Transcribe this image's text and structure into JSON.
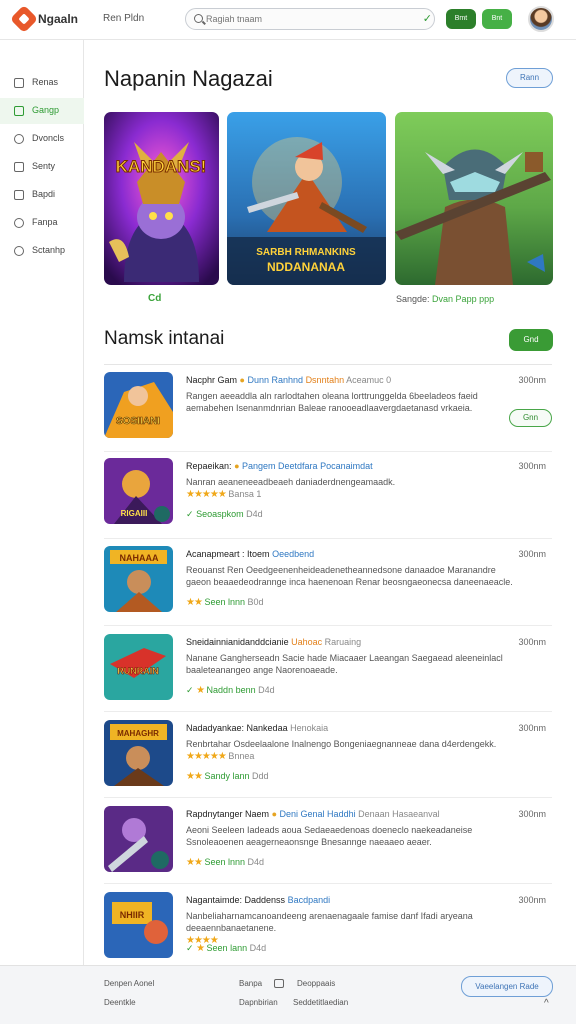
{
  "header": {
    "brand": "Ngaaln",
    "top_link": "Ren Pldn",
    "search_placeholder": "Ragiah tnaam",
    "btn_primary": "Bmt",
    "btn_secondary": "Bnt"
  },
  "sidebar": {
    "items": [
      {
        "label": "Renas",
        "icon": "home-icon",
        "active": false
      },
      {
        "label": "Gangp",
        "icon": "game-icon",
        "active": true
      },
      {
        "label": "Dvoncls",
        "icon": "chat-icon",
        "active": false
      },
      {
        "label": "Senty",
        "icon": "list-icon",
        "active": false
      },
      {
        "label": "Bapdi",
        "icon": "bag-icon",
        "active": false
      },
      {
        "label": "Fanpa",
        "icon": "circle-icon",
        "active": false
      },
      {
        "label": "Sctanhp",
        "icon": "settings-icon",
        "active": false
      }
    ]
  },
  "featured": {
    "title": "Napanin Nagazai",
    "outline_button": "Rann",
    "tiles": [
      {
        "art_text": "KANDANS!"
      },
      {
        "art_text": "SARBH RHMANKINS",
        "art_text2": "NDDANANAA"
      },
      {
        "art_text": ""
      }
    ],
    "left_label": "Cd",
    "right_label": "Sangde:",
    "right_label_highlight": "Dvan Papp ppp"
  },
  "list": {
    "title": "Namsk intanai",
    "header_button": "Gnd",
    "rows": [
      {
        "name": "Nacphr Gam",
        "tag": "Dunn Ranhnd",
        "tag2": "Dsnntahn",
        "extra": "Aceamuc 0",
        "time": "300nm",
        "desc": "Rangen aeeaddla aln rarlodtahen oleana lorttrunggelda 6beeladeos faeid aemabehen Isenanmdnrian Baleae ranooeadlaavergdaetanasd vrkaeia.",
        "meta": "",
        "thumb_text": "SOSIIANI",
        "action": "Gnn"
      },
      {
        "name": "Repaeikan:",
        "tag": "Pangem Deetdfara",
        "tag2": "Pocanaimdat",
        "time": "300nm",
        "desc": "Nanran aeaneneeadbeaeh daniaderdnengeamaadk.",
        "stars": "★★★★★",
        "rating": "Bansa 1",
        "meta": "Seoaspkom",
        "meta_small": "D4d",
        "thumb_text": "RIGAIII"
      },
      {
        "name": "Acanapmeart : Itoem",
        "tag": "Oeedbend",
        "time": "300nm",
        "desc": "Reouanst Ren Oeedgeenenheideadenetheannedsone danaadoe Maranandre gaeon beaaedeodrannge inca haenenoan Renar beosngaeonecsa daneenaeacle.",
        "stars": "★★",
        "meta": "Seen lnnn",
        "meta_small": "B0d",
        "thumb_text": "NAHAAA"
      },
      {
        "name": "Sneidainnianidanddcianie",
        "tag": "Uahoac",
        "tag2": "Raruaing",
        "time": "300nm",
        "desc": "Nanane Gangherseadn Sacie hade Miacaaer Laeangan Saegaead aleeneinlacl baaleteanangeo ange Naorenoaeade.",
        "stars": "★",
        "meta": "Naddn benn",
        "meta_small": "D4d",
        "thumb_text": "RUNRAIN"
      },
      {
        "name": "Nadadyankae: Nankedaa",
        "tag2": "Henokaia",
        "time": "300nm",
        "desc": "Renbrtahar Osdeelaalone Inalnengo Bongeniaegnanneae dana d4erdengekk.",
        "stars": "★★★★★",
        "rating": "Bnnea",
        "meta": "Sandy lann",
        "meta_small": "Ddd",
        "thumb_text": "MAHAGHR"
      },
      {
        "name": "Rapdnytanger Naem",
        "tag": "Deni Genal Haddhi",
        "tag2": "Denaan Hasaeanval",
        "time": "300nm",
        "desc": "Aeoni Seeleen Iadeads aoua Sedaeaedenoas doeneclo naekeadaneise Ssnoleaoenen aeagerneaonsnge Bnesannge naeaaeo aeaer.",
        "stars": "★★",
        "meta": "Seen lnnn",
        "meta_small": "D4d",
        "thumb_text": ""
      },
      {
        "name": "Nagantaimde: Daddenss",
        "tag": "Bacdpandi",
        "time": "300nm",
        "desc": "Nanbeliaharnamcanoandeeng arenaenagaale famise danf Ifadi aryeana deeaennbanaetanene.",
        "stars": "★★★★",
        "meta": "Seen lann",
        "meta_small": "D4d",
        "thumb_text": "NHIIR"
      }
    ]
  },
  "footer": {
    "col1_a": "Denpen Aonel",
    "col1_b": "Deentkle",
    "col2_a": "Banpa",
    "col2_b": "Dapnbirian",
    "col3_a": "Deoppaais",
    "col3_b": "Seddetitlaedian",
    "button": "Vaeelangen Rade"
  },
  "colors": {
    "accent_green": "#3a9b35",
    "accent_blue": "#3f74b6",
    "brand_orange": "#e8582a"
  }
}
